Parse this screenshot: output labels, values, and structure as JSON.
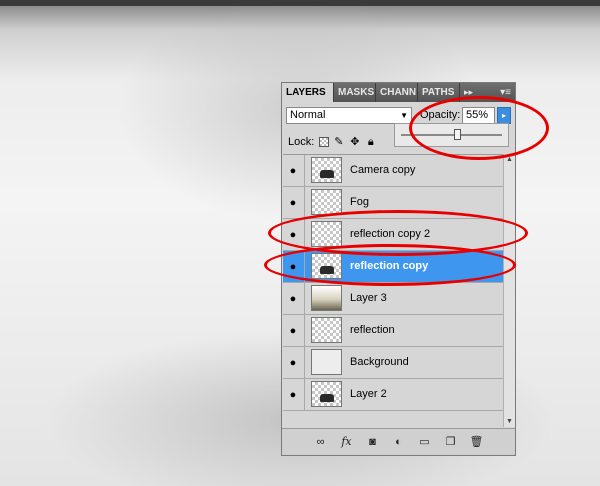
{
  "panel": {
    "tabs": [
      {
        "label": "LAYERS",
        "active": true
      },
      {
        "label": "MASKS",
        "active": false
      },
      {
        "label": "CHANN",
        "active": false
      },
      {
        "label": "PATHS",
        "active": false
      }
    ],
    "tab_arrows": "▸▸",
    "tab_menu": "▾≡",
    "blend_mode": "Normal",
    "opacity_label": "Opacity:",
    "opacity_value": "55%",
    "opacity_fraction": 0.55,
    "lock_label": "Lock:",
    "layers": [
      {
        "name": "Camera copy",
        "visible": true,
        "thumb": "checker-shape",
        "selected": false
      },
      {
        "name": "Fog",
        "visible": true,
        "thumb": "checker",
        "selected": false
      },
      {
        "name": "reflection copy 2",
        "visible": true,
        "thumb": "checker",
        "selected": false
      },
      {
        "name": "reflection copy",
        "visible": true,
        "thumb": "checker-shape",
        "selected": true
      },
      {
        "name": "Layer 3",
        "visible": true,
        "thumb": "gradient",
        "selected": false
      },
      {
        "name": "reflection",
        "visible": true,
        "thumb": "checker",
        "selected": false
      },
      {
        "name": "Background",
        "visible": true,
        "thumb": "white",
        "selected": false
      },
      {
        "name": "Layer 2",
        "visible": true,
        "thumb": "checker-shape",
        "selected": false
      }
    ],
    "footer_icons": [
      "link-icon",
      "fx-icon",
      "mask-icon",
      "adjustment-icon",
      "group-folder-icon",
      "new-layer-icon",
      "trash-icon"
    ]
  },
  "colors": {
    "selection": "#3e96ef",
    "annotation_red": "#e80000"
  }
}
